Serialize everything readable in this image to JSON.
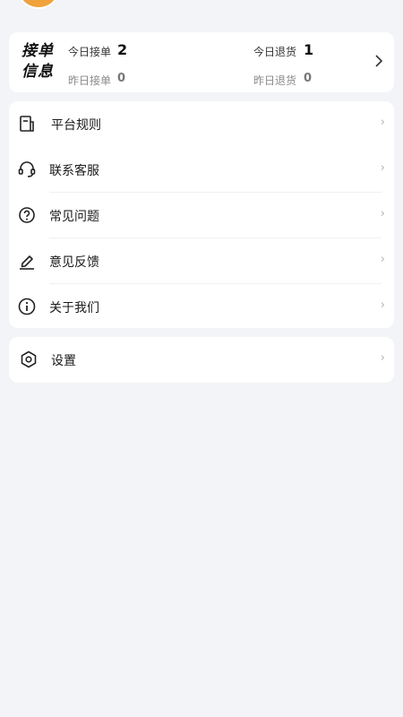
{
  "order_info": {
    "brand_line1": "接单",
    "brand_line2": "信息",
    "today_orders_label": "今日接单",
    "today_orders_value": "2",
    "yesterday_orders_label": "昨日接单",
    "yesterday_orders_value": "0",
    "today_returns_label": "今日退货",
    "today_returns_value": "1",
    "yesterday_returns_label": "昨日退货",
    "yesterday_returns_value": "0",
    "arrow_icon": "chevron-right-icon"
  },
  "menu": {
    "items": [
      {
        "label": "平台规则",
        "icon": "document-icon"
      },
      {
        "label": "联系客服",
        "icon": "headset-icon"
      },
      {
        "label": "常见问题",
        "icon": "question-circle-icon"
      },
      {
        "label": "意见反馈",
        "icon": "edit-pen-icon"
      },
      {
        "label": "关于我们",
        "icon": "info-circle-icon"
      }
    ]
  },
  "settings": {
    "label": "设置",
    "icon": "hexagon-settings-icon"
  },
  "chevron": "›",
  "colors": {
    "background": "#f3f4f8",
    "card": "#ffffff",
    "avatar": "#f0a23c"
  }
}
